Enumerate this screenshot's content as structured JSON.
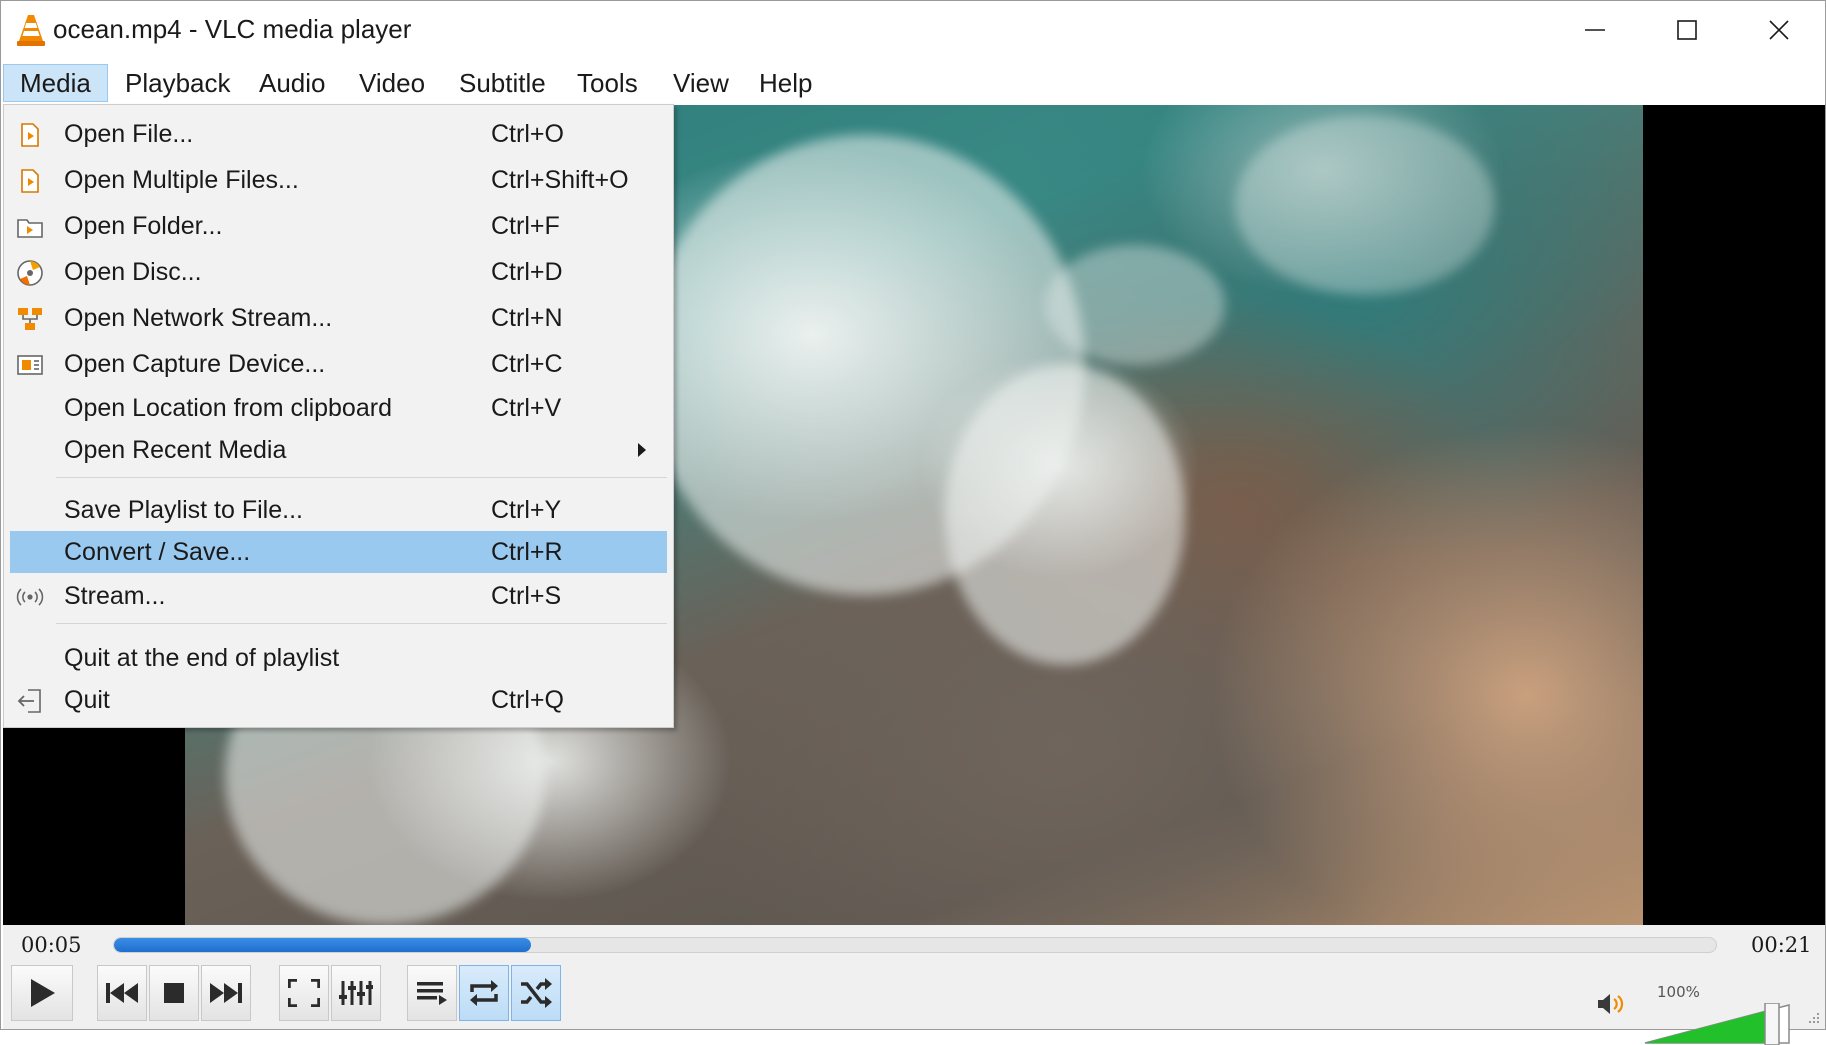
{
  "window": {
    "title": "ocean.mp4 - VLC media player",
    "app_icon": "vlc-cone-icon",
    "buttons": [
      "minimize-icon",
      "maximize-icon",
      "close-icon"
    ]
  },
  "menubar": {
    "items": [
      {
        "label": "Media",
        "active": true
      },
      {
        "label": "Playback"
      },
      {
        "label": "Audio"
      },
      {
        "label": "Video"
      },
      {
        "label": "Subtitle"
      },
      {
        "label": "Tools"
      },
      {
        "label": "View"
      },
      {
        "label": "Help"
      }
    ]
  },
  "media_menu": {
    "items": [
      {
        "label": "Open File...",
        "shortcut": "Ctrl+O",
        "icon": "open-file-icon"
      },
      {
        "label": "Open Multiple Files...",
        "shortcut": "Ctrl+Shift+O",
        "icon": "open-multiple-files-icon"
      },
      {
        "label": "Open Folder...",
        "shortcut": "Ctrl+F",
        "icon": "folder-icon"
      },
      {
        "label": "Open Disc...",
        "shortcut": "Ctrl+D",
        "icon": "disc-icon"
      },
      {
        "label": "Open Network Stream...",
        "shortcut": "Ctrl+N",
        "icon": "network-icon"
      },
      {
        "label": "Open Capture Device...",
        "shortcut": "Ctrl+C",
        "icon": "capture-device-icon"
      },
      {
        "label": "Open Location from clipboard",
        "shortcut": "Ctrl+V"
      },
      {
        "label": "Open Recent Media",
        "submenu": true
      },
      {
        "label": "Save Playlist to File...",
        "shortcut": "Ctrl+Y"
      },
      {
        "label": "Convert / Save...",
        "shortcut": "Ctrl+R",
        "highlighted": true
      },
      {
        "label": "Stream...",
        "shortcut": "Ctrl+S",
        "icon": "stream-icon"
      },
      {
        "label": "Quit at the end of playlist"
      },
      {
        "label": "Quit",
        "shortcut": "Ctrl+Q",
        "icon": "quit-icon"
      }
    ]
  },
  "player": {
    "time_elapsed": "00:05",
    "time_total": "00:21",
    "progress": 0.26,
    "volume_label": "100%",
    "volume": 1.0,
    "controls": [
      "play-icon",
      "previous-icon",
      "stop-icon",
      "next-icon",
      "fullscreen-icon",
      "extended-settings-icon",
      "playlist-icon",
      "loop-icon",
      "random-icon"
    ],
    "toggled": [
      "loop",
      "random"
    ]
  },
  "colors": {
    "menu_highlight": "#99c9ef",
    "active_menu": "#cce4f7",
    "seek_fill": "#1f6fcf",
    "volume_fill": "#22c02a",
    "vlc_orange": "#f08a00"
  }
}
